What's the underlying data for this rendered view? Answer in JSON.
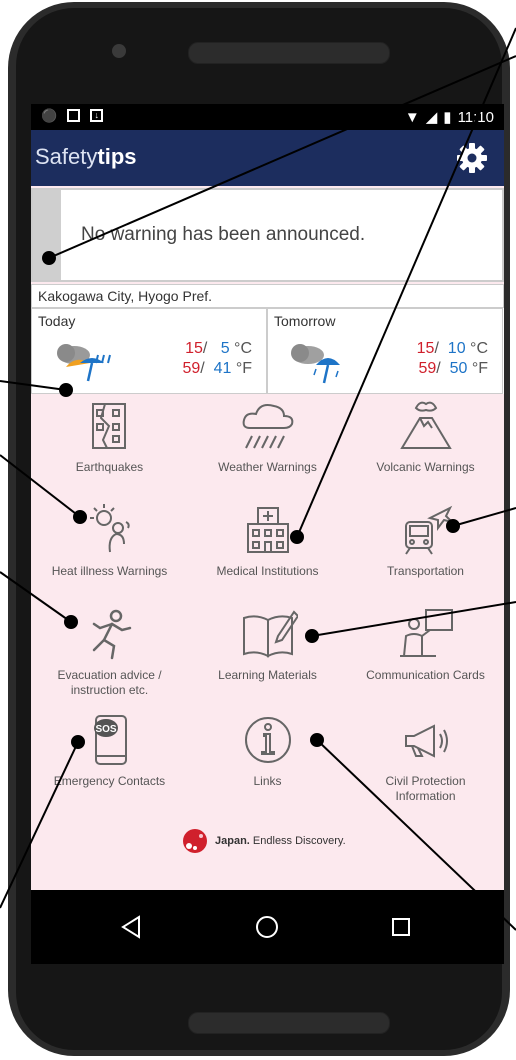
{
  "status_bar": {
    "time": "11:10"
  },
  "app_bar": {
    "title_part1": "Safety",
    "title_part2": "tips"
  },
  "warning": {
    "message": "No warning has been announced."
  },
  "location": "Kakogawa City, Hyogo Pref.",
  "weather": {
    "today": {
      "label": "Today",
      "hi_c": "15",
      "lo_c": "5",
      "hi_f": "59",
      "lo_f": "41"
    },
    "tomorrow": {
      "label": "Tomorrow",
      "hi_c": "15",
      "lo_c": "10",
      "hi_f": "59",
      "lo_f": "50"
    },
    "slash": "/",
    "unit_c": "°C",
    "unit_f": "°F"
  },
  "menu": {
    "earthquakes": "Earthquakes",
    "weather_warnings": "Weather Warnings",
    "volcanic_warnings": "Volcanic Warnings",
    "heat_illness": "Heat illness Warnings",
    "medical": "Medical Institutions",
    "transportation": "Transportation",
    "evacuation_line1": "Evacuation advice /",
    "evacuation_line2": "instruction etc.",
    "learning": "Learning Materials",
    "communication": "Communication Cards",
    "emergency": "Emergency Contacts",
    "links": "Links",
    "civil_line1": "Civil Protection",
    "civil_line2": "Information",
    "sos_text": "SOS"
  },
  "footer": {
    "logo_bold": "Japan.",
    "logo_text": "Endless Discovery."
  }
}
